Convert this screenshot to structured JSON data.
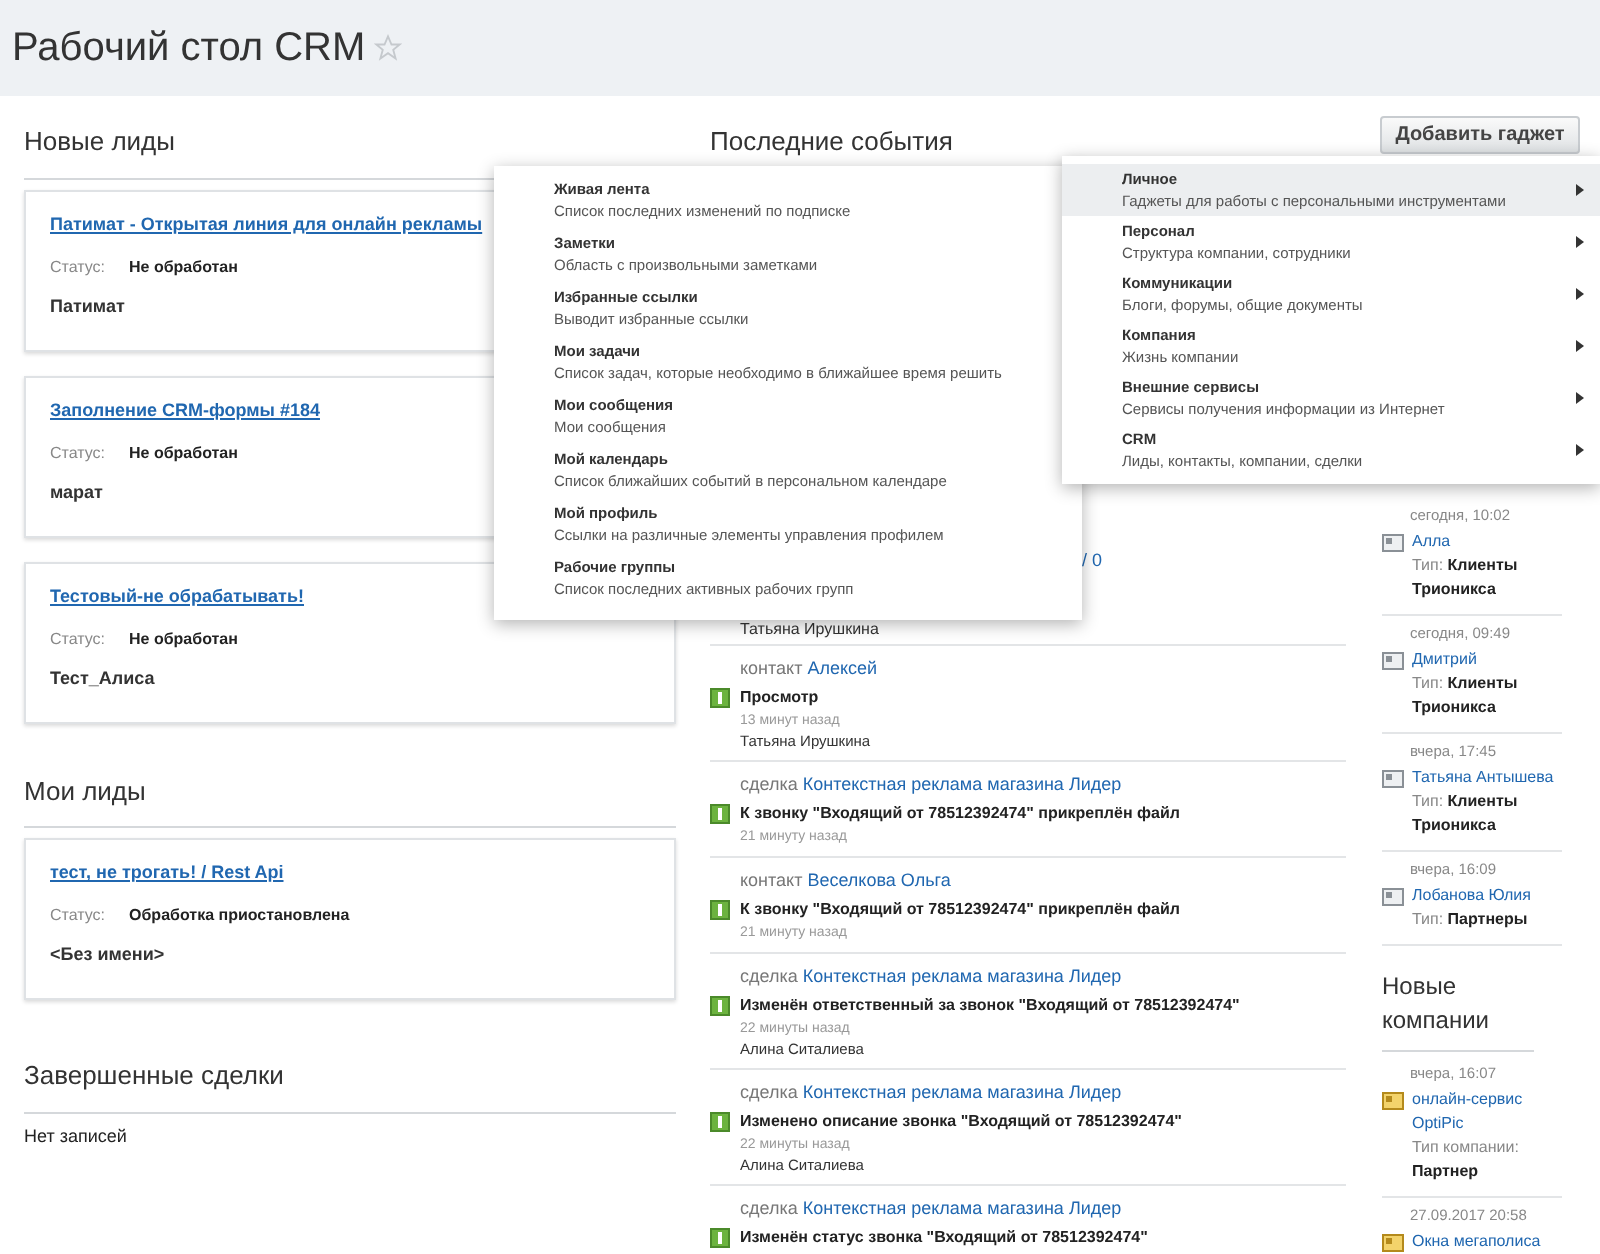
{
  "page": {
    "title": "Рабочий стол CRM",
    "favorite": false
  },
  "add_gadget_button": "Добавить гаджет",
  "new_leads": {
    "title": "Новые лиды",
    "items": [
      {
        "title": "Патимат - Открытая линия для онлайн рекламы",
        "status_label": "Статус:",
        "status": "Не обработан",
        "name": "Патимат"
      },
      {
        "title": "Заполнение CRM-формы #184",
        "status_label": "Статус:",
        "status": "Не обработан",
        "name": "марат"
      },
      {
        "title": "Тестовый-не обрабатывать!",
        "status_label": "Статус:",
        "status": "Не обработан",
        "name": "Тест_Алиса"
      }
    ]
  },
  "my_leads": {
    "title": "Мои лиды",
    "items": [
      {
        "title": "тест, не трогать! / Rest Api",
        "status_label": "Статус:",
        "status": "Обработка приостановлена",
        "name": "<Без имени>"
      }
    ]
  },
  "closed_deals": {
    "title": "Завершенные сделки",
    "empty": "Нет записей"
  },
  "recent_events": {
    "title": "Последние события",
    "items": [
      {
        "kind": "partial",
        "fragment": "/ 0",
        "author": "Татьяна Ирушкина"
      },
      {
        "kind": "event",
        "entity": "контакт",
        "link": "Алексей",
        "action": "Просмотр",
        "time": "13 минут назад",
        "author": "Татьяна Ирушкина"
      },
      {
        "kind": "event",
        "entity": "сделка",
        "link": "Контекстная реклама магазина Лидер",
        "action": "К звонку \"Входящий от 78512392474\" прикреплён файл",
        "time": "21 минуту назад"
      },
      {
        "kind": "event",
        "entity": "контакт",
        "link": "Веселкова Ольга",
        "action": "К звонку \"Входящий от 78512392474\" прикреплён файл",
        "time": "21 минуту назад"
      },
      {
        "kind": "event",
        "entity": "сделка",
        "link": "Контекстная реклама магазина Лидер",
        "action": "Изменён ответственный за звонок \"Входящий от 78512392474\"",
        "time": "22 минуты назад",
        "author": "Алина Ситалиева"
      },
      {
        "kind": "event",
        "entity": "сделка",
        "link": "Контекстная реклама магазина Лидер",
        "action": "Изменено описание звонка \"Входящий от 78512392474\"",
        "time": "22 минуты назад",
        "author": "Алина Ситалиева"
      },
      {
        "kind": "event",
        "entity": "сделка",
        "link": "Контекстная реклама магазина Лидер",
        "action": "Изменён статус звонка \"Входящий от 78512392474\""
      }
    ]
  },
  "new_contacts": {
    "items": [
      {
        "date": "сегодня, 10:02",
        "name": "Алла",
        "type_label": "Тип:",
        "type": "Клиенты Трионикса"
      },
      {
        "date": "сегодня, 09:49",
        "name": "Дмитрий",
        "type_label": "Тип:",
        "type": "Клиенты Трионикса"
      },
      {
        "date": "вчера, 17:45",
        "name": "Татьяна Антышева",
        "type_label": "Тип:",
        "type": "Клиенты Трионикса"
      },
      {
        "date": "вчера, 16:09",
        "name": "Лобанова Юлия",
        "type_label": "Тип:",
        "type": "Партнеры"
      }
    ]
  },
  "new_companies": {
    "title": "Новые компании",
    "items": [
      {
        "date": "вчера, 16:07",
        "name": "онлайн-сервис OptiPic",
        "type_label": "Тип компании:",
        "type": "Партнер"
      },
      {
        "date": "27.09.2017 20:58",
        "name": "Окна мегаполиса"
      }
    ]
  },
  "gadget_menu": {
    "items": [
      {
        "title": "Личное",
        "description": "Гаджеты для работы с персональными инструментами",
        "selected": true
      },
      {
        "title": "Персонал",
        "description": "Структура компании, сотрудники",
        "selected": false
      },
      {
        "title": "Коммуникации",
        "description": "Блоги, форумы, общие документы",
        "selected": false
      },
      {
        "title": "Компания",
        "description": "Жизнь компании",
        "selected": false
      },
      {
        "title": "Внешние сервисы",
        "description": "Сервисы получения информации из Интернет",
        "selected": false
      },
      {
        "title": "CRM",
        "description": "Лиды, контакты, компании, сделки",
        "selected": false
      }
    ]
  },
  "gadget_submenu": {
    "items": [
      {
        "title": "Живая лента",
        "description": "Список последних изменений по подписке"
      },
      {
        "title": "Заметки",
        "description": "Область с произвольными заметками"
      },
      {
        "title": "Избранные ссылки",
        "description": "Выводит избранные ссылки"
      },
      {
        "title": "Мои задачи",
        "description": "Список задач, которые необходимо в ближайшее время решить"
      },
      {
        "title": "Мои сообщения",
        "description": "Мои сообщения"
      },
      {
        "title": "Мой календарь",
        "description": "Список ближайших событий в персональном календаре"
      },
      {
        "title": "Мой профиль",
        "description": "Ссылки на различные элементы управления профилем"
      },
      {
        "title": "Рабочие группы",
        "description": "Список последних активных рабочих групп"
      }
    ]
  }
}
